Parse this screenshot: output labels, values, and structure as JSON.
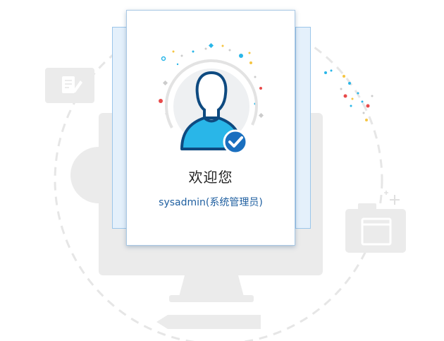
{
  "welcome_card": {
    "greeting": "欢迎您",
    "user_role": "sysadmin(系统管理员)"
  },
  "icons": {
    "avatar": "user-avatar-verified-icon",
    "check": "check-circle-icon",
    "edit": "edit-document-icon",
    "camera": "camera-window-icon",
    "monitor": "monitor-icon"
  },
  "colors": {
    "accent": "#1a6fbf",
    "avatar_fill": "#29b6e8",
    "avatar_outline": "#0e4a80",
    "illustration_gray": "#ebebeb",
    "text_primary": "#222222",
    "text_link": "#1f5fa0"
  }
}
